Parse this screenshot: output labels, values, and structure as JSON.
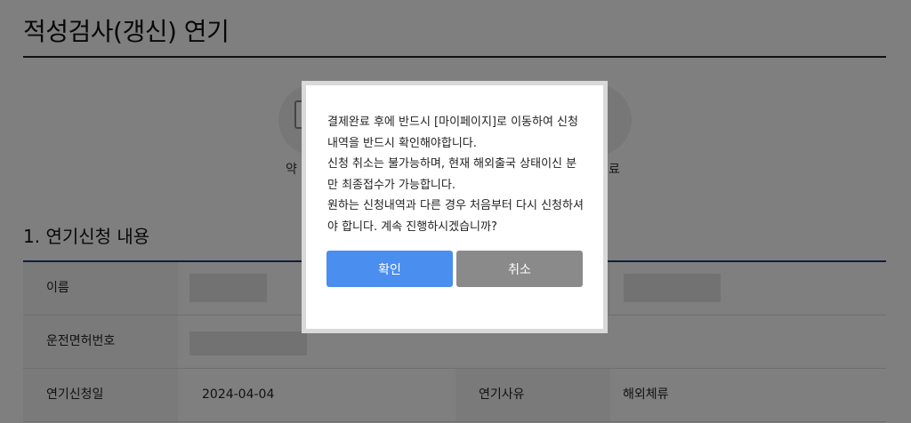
{
  "page": {
    "title": "적성검사(갱신) 연기"
  },
  "steps": {
    "left_label": "약",
    "right_label": "료"
  },
  "section": {
    "title": "1. 연기신청 내용"
  },
  "table": {
    "name_label": "이름",
    "license_label": "운전면허번호",
    "date_label": "연기신청일",
    "date_value": "2024-04-04",
    "reason_label": "연기사유",
    "reason_value": "해외체류"
  },
  "modal": {
    "lines": [
      "결제완료 후에 반드시 [마이페이지]로 이동하여 신청",
      "내역을 반드시 확인해야합니다.",
      "신청 취소는 불가능하며, 현재 해외출국 상태이신 분",
      "만 최종접수가 가능합니다.",
      "원하는 신청내역과 다른 경우 처음부터 다시 신청하셔",
      "야 합니다. 계속 진행하시겠습니까?"
    ],
    "confirm_label": "확인",
    "cancel_label": "취소"
  },
  "colors": {
    "confirm": "#4a8ef0",
    "cancel": "#8a8a8a",
    "section_rule": "#1f3a7a"
  }
}
